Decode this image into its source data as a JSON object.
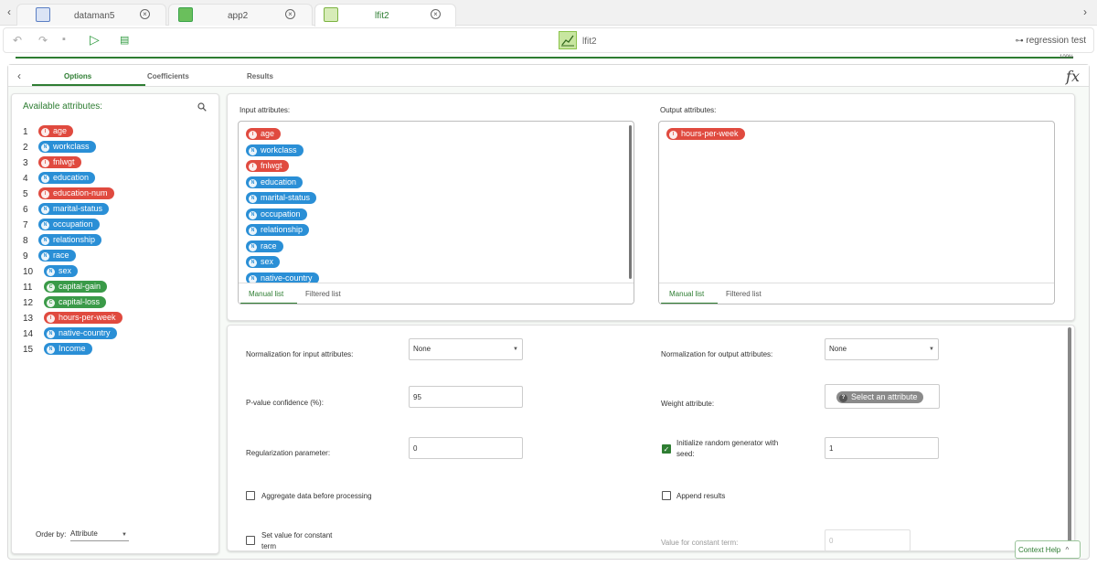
{
  "tabs": [
    {
      "label": "dataman5",
      "icon": "dataman-icon",
      "color": "#5b7fc4"
    },
    {
      "label": "app2",
      "icon": "app-icon",
      "color": "#3aa34a"
    },
    {
      "label": "lfit2",
      "icon": "lfit-icon",
      "color": "#7cb342",
      "active": true
    }
  ],
  "toolbar": {
    "title": "lfit2",
    "project": "regression test",
    "progress": "100%",
    "progress_value": 1.0
  },
  "subtabs": [
    "Options",
    "Coefficients",
    "Results"
  ],
  "fx_label": "fx",
  "available": {
    "title": "Available attributes:",
    "items": [
      {
        "num": "1",
        "type": "I",
        "name": "age"
      },
      {
        "num": "2",
        "type": "N",
        "name": "workclass"
      },
      {
        "num": "3",
        "type": "I",
        "name": "fnlwgt"
      },
      {
        "num": "4",
        "type": "N",
        "name": "education"
      },
      {
        "num": "5",
        "type": "I",
        "name": "education-num"
      },
      {
        "num": "6",
        "type": "N",
        "name": "marital-status"
      },
      {
        "num": "7",
        "type": "N",
        "name": "occupation"
      },
      {
        "num": "8",
        "type": "N",
        "name": "relationship"
      },
      {
        "num": "9",
        "type": "N",
        "name": "race"
      },
      {
        "num": "10",
        "type": "N",
        "name": "sex"
      },
      {
        "num": "11",
        "type": "C",
        "name": "capital-gain"
      },
      {
        "num": "12",
        "type": "C",
        "name": "capital-loss"
      },
      {
        "num": "13",
        "type": "I",
        "name": "hours-per-week"
      },
      {
        "num": "14",
        "type": "N",
        "name": "native-country"
      },
      {
        "num": "15",
        "type": "N",
        "name": "Income"
      }
    ],
    "order_label": "Order by:",
    "order_value": "Attribute"
  },
  "input_attrs": {
    "label": "Input attributes:",
    "items": [
      {
        "type": "I",
        "name": "age"
      },
      {
        "type": "N",
        "name": "workclass"
      },
      {
        "type": "I",
        "name": "fnlwgt"
      },
      {
        "type": "N",
        "name": "education"
      },
      {
        "type": "N",
        "name": "marital-status"
      },
      {
        "type": "N",
        "name": "occupation"
      },
      {
        "type": "N",
        "name": "relationship"
      },
      {
        "type": "N",
        "name": "race"
      },
      {
        "type": "N",
        "name": "sex"
      },
      {
        "type": "N",
        "name": "native-country"
      }
    ],
    "tab_manual": "Manual list",
    "tab_filtered": "Filtered list"
  },
  "output_attrs": {
    "label": "Output attributes:",
    "items": [
      {
        "type": "I",
        "name": "hours-per-week"
      }
    ],
    "tab_manual": "Manual list",
    "tab_filtered": "Filtered list"
  },
  "options": {
    "norm_input_label": "Normalization for input attributes:",
    "norm_input_value": "None",
    "norm_output_label": "Normalization for output attributes:",
    "norm_output_value": "None",
    "pvalue_label": "P-value confidence (%):",
    "pvalue_value": "95",
    "weight_label": "Weight attribute:",
    "weight_placeholder": "Select an attribute",
    "weight_type": "?",
    "reg_label": "Regularization parameter:",
    "reg_value": "0",
    "init_random_label_1": "Initialize random generator with",
    "init_random_label_2": "seed:",
    "init_random_checked": true,
    "seed_value": "1",
    "aggregate_label": "Aggregate data before processing",
    "aggregate_checked": false,
    "append_label": "Append results",
    "append_checked": false,
    "const_label_1": "Set value for constant",
    "const_label_2": "term",
    "const_checked": false,
    "const_value_label": "Value for constant term:",
    "const_value": "0"
  },
  "context_help": "Context Help"
}
